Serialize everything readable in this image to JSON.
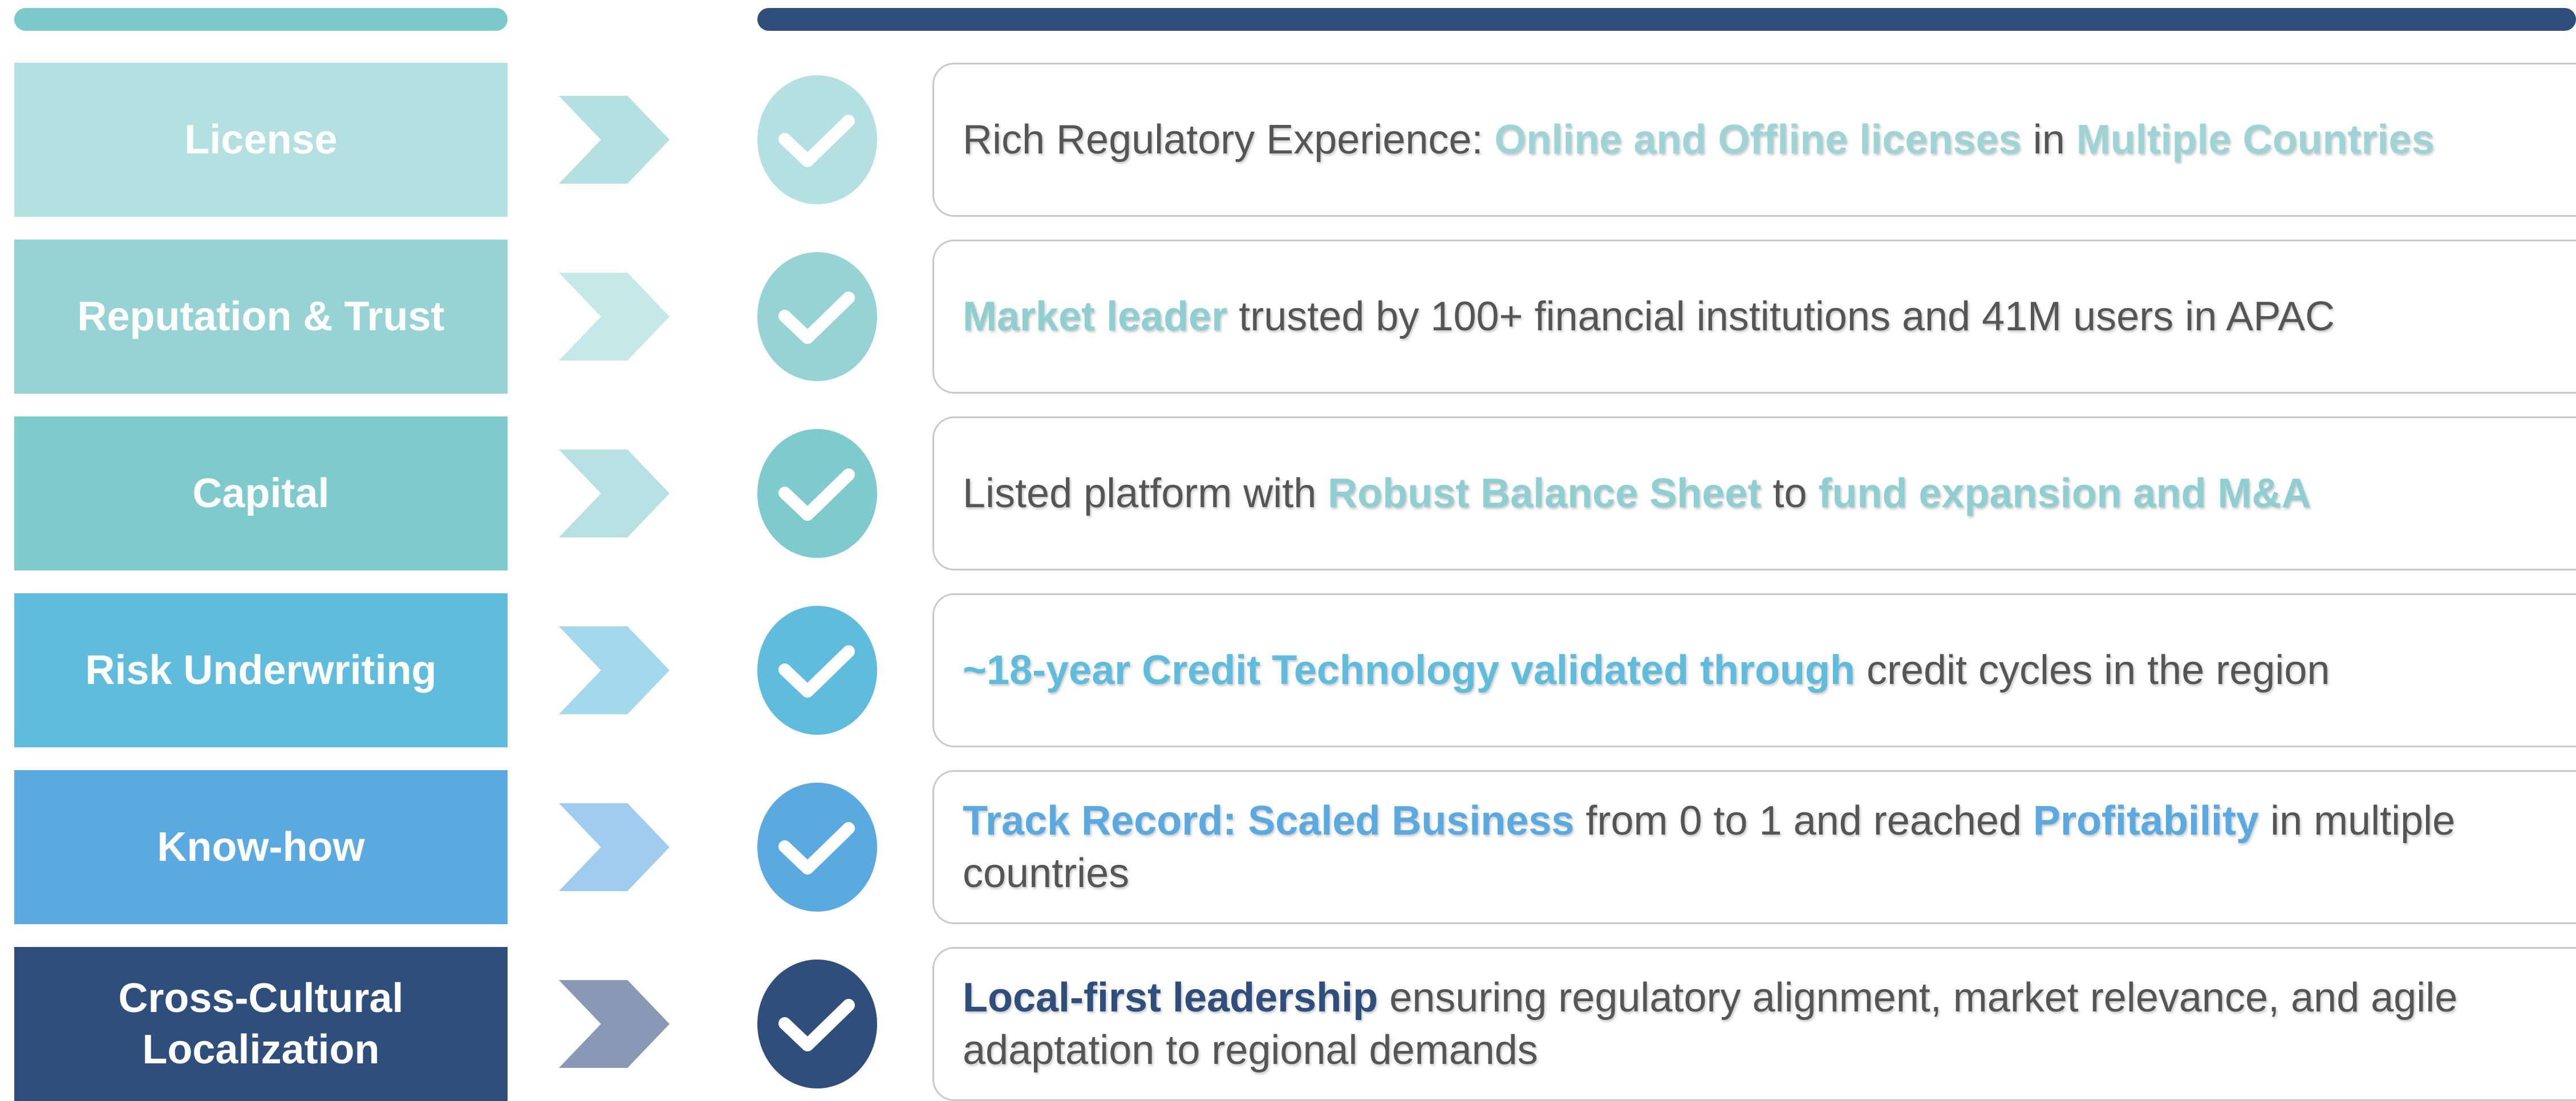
{
  "colors": {
    "top_bar_left": "#7cc9cc",
    "top_bar_right": "#2f4e7c",
    "body_text": "#555555",
    "box_border": "#c9c9c9"
  },
  "rows": [
    {
      "label": "License",
      "label_bg": "#b4e0e1",
      "arrow_color": "#b4e0e1",
      "check_color": "#b4e0e1",
      "highlight_color": "#9fd4d6",
      "desc": {
        "t1": "Rich Regulatory Experience: ",
        "h1": "Online and Offline licenses",
        "t2": " in ",
        "h2": "Multiple Countries"
      }
    },
    {
      "label": "Reputation & Trust",
      "label_bg": "#97d3d4",
      "arrow_color": "#c5e8e9",
      "check_color": "#97d3d4",
      "highlight_color": "#8fcfd1",
      "desc": {
        "h1": "Market leader",
        "t1": " trusted by 100+ financial institutions and 41M users in APAC"
      }
    },
    {
      "label": "Capital",
      "label_bg": "#7ecacc",
      "arrow_color": "#b6e0e1",
      "check_color": "#7ecacc",
      "highlight_color": "#8fcfd1",
      "desc": {
        "t1": "Listed platform with ",
        "h1": "Robust Balance Sheet",
        "t2": " to ",
        "h2": "fund expansion and M&A"
      }
    },
    {
      "label": "Risk Underwriting",
      "label_bg": "#5fbcdc",
      "arrow_color": "#a3d8ed",
      "check_color": "#5fbcdc",
      "highlight_color": "#5fbcdc",
      "desc": {
        "h1": "~18-year Credit Technology validated through",
        "t1": " credit cycles in the region"
      }
    },
    {
      "label": "Know-how",
      "label_bg": "#5aa9e0",
      "arrow_color": "#9fccef",
      "check_color": "#5aa9e0",
      "highlight_color": "#5aa9e0",
      "desc": {
        "h1": "Track Record: Scaled Business",
        "t1": " from 0 to 1 and reached ",
        "h2": "Profitability",
        "t2": " in multiple countries"
      }
    },
    {
      "label": "Cross-Cultural\nLocalization",
      "label_bg": "#2f4e7c",
      "arrow_color": "#8799b4",
      "check_color": "#2f4e7c",
      "highlight_color": "#2f4e7c",
      "desc": {
        "h1": "Local-first leadership",
        "t1": " ensuring regulatory alignment, market relevance, and agile adaptation to regional demands"
      }
    }
  ]
}
